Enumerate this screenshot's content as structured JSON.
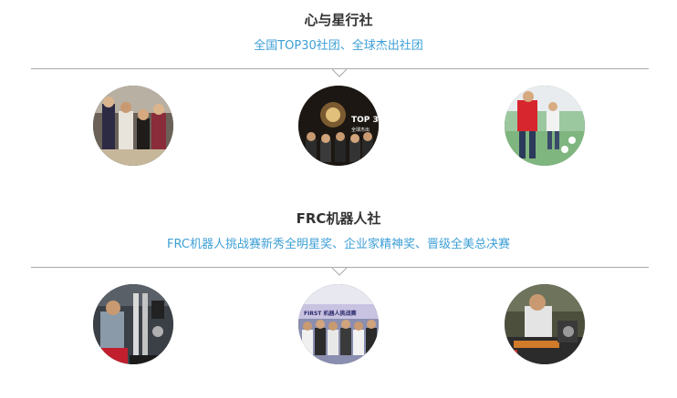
{
  "clubs": [
    {
      "title": "心与星行社",
      "subtitle": "全国TOP30社团、全球杰出社团",
      "photos": [
        {
          "icon": "group-photo-icon"
        },
        {
          "icon": "stage-award-photo-icon"
        },
        {
          "icon": "outdoor-activity-photo-icon"
        }
      ],
      "overlay_texts": [
        "TOP 3",
        "全球杰出"
      ]
    },
    {
      "title": "FRC机器人社",
      "subtitle": "FRC机器人挑战赛新秀全明星奖、企业家精神奖、晋级全美总决赛",
      "photos": [
        {
          "icon": "robot-building-photo-icon"
        },
        {
          "icon": "competition-team-photo-icon"
        },
        {
          "icon": "robot-workshop-photo-icon"
        }
      ],
      "overlay_texts": [
        "FIRST 机器人挑战赛"
      ]
    }
  ],
  "colors": {
    "title": "#333333",
    "subtitle": "#3d9fd6",
    "divider": "#a9a9a9"
  }
}
